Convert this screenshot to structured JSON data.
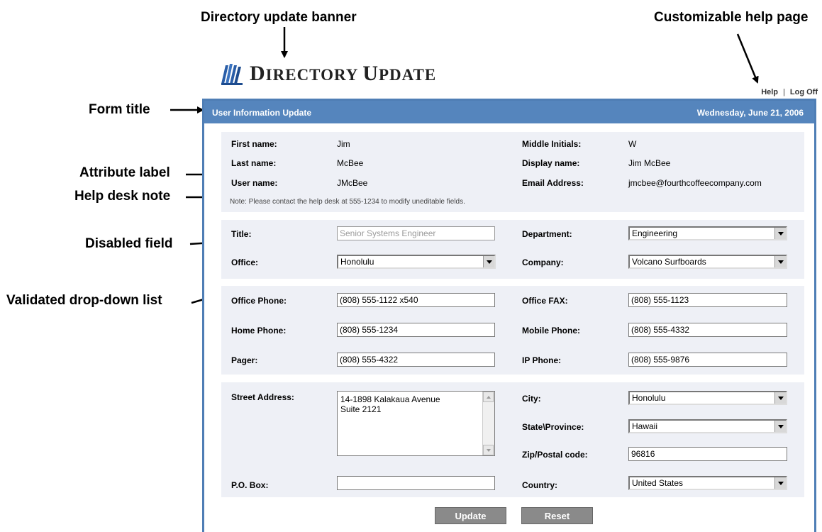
{
  "callouts": {
    "banner": "Directory update banner",
    "help_page": "Customizable help page",
    "form_title": "Form title",
    "attribute_label": "Attribute label",
    "help_desk_note": "Help desk note",
    "disabled_field": "Disabled field",
    "validated_dropdown": "Validated drop-down list"
  },
  "logo": {
    "first_big": "D",
    "rest1": "IRECTORY ",
    "second_big": "U",
    "rest2": "PDATE"
  },
  "toplinks": {
    "help": "Help",
    "separator": "|",
    "logoff": "Log Off"
  },
  "header": {
    "title": "User Information Update",
    "date": "Wednesday, June 21, 2006"
  },
  "readonly": {
    "first_name_label": "First name:",
    "first_name": "Jim",
    "middle_label": "Middle Initials:",
    "middle": "W",
    "last_name_label": "Last name:",
    "last_name": "McBee",
    "display_label": "Display name:",
    "display": "Jim McBee",
    "user_label": "User name:",
    "user": "JMcBee",
    "email_label": "Email Address:",
    "email": "jmcbee@fourthcoffeecompany.com",
    "note": "Note: Please contact the help desk at 555-1234 to modify uneditable fields."
  },
  "org": {
    "title_label": "Title:",
    "title_value": "Senior Systems Engineer",
    "department_label": "Department:",
    "department_value": "Engineering",
    "office_label": "Office:",
    "office_value": "Honolulu",
    "company_label": "Company:",
    "company_value": "Volcano Surfboards"
  },
  "phones": {
    "office_phone_label": "Office Phone:",
    "office_phone": "(808) 555-1122 x540",
    "office_fax_label": "Office FAX:",
    "office_fax": "(808) 555-1123",
    "home_phone_label": "Home Phone:",
    "home_phone": "(808) 555-1234",
    "mobile_label": "Mobile Phone:",
    "mobile": "(808) 555-4332",
    "pager_label": "Pager:",
    "pager": "(808) 555-4322",
    "ip_phone_label": "IP Phone:",
    "ip_phone": "(808) 555-9876"
  },
  "address": {
    "street_label": "Street Address:",
    "street_line1": "14-1898 Kalakaua Avenue",
    "street_line2": "Suite 2121",
    "city_label": "City:",
    "city": "Honolulu",
    "state_label": "State\\Province:",
    "state": "Hawaii",
    "zip_label": "Zip/Postal code:",
    "zip": "96816",
    "pobox_label": "P.O. Box:",
    "pobox": "",
    "country_label": "Country:",
    "country": "United States"
  },
  "buttons": {
    "update": "Update",
    "reset": "Reset"
  },
  "colors": {
    "titlebar": "#5585bd",
    "section_bg": "#eef0f6",
    "button": "#8a8a8a"
  }
}
